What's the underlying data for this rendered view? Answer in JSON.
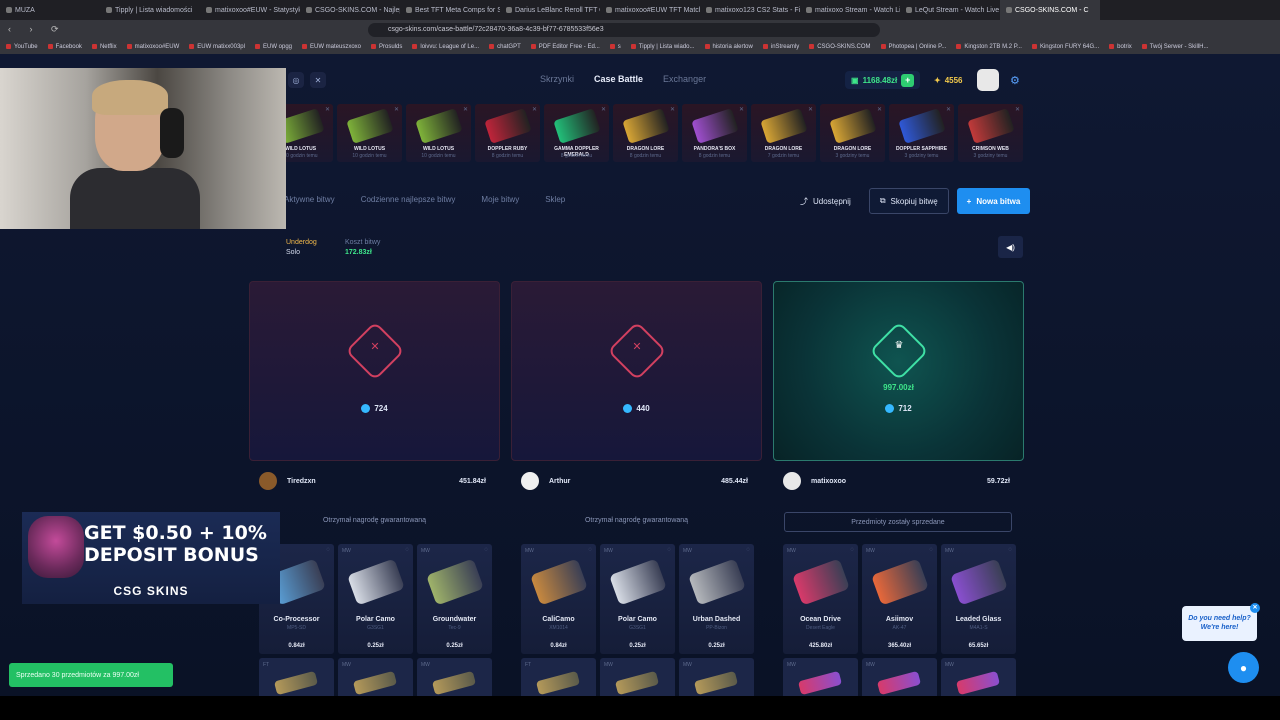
{
  "browser": {
    "tabs": [
      "MUZA",
      "Tipply | Lista wiadomości",
      "matixoxoo#EUW - Statystyki",
      "CSGO-SKINS.COM - Najlepsz",
      "Best TFT Meta Comps for Set",
      "Darius LeBlanc Reroll TFT Co",
      "matixoxoo#EUW TFT Match",
      "matixoxo123 CS2 Stats - Fi",
      "matixoxo Stream - Watch Li",
      "LeQut Stream - Watch Live o",
      "CSGO-SKINS.COM - C"
    ],
    "url": "csgo-skins.com/case-battle/72c28470-36a8-4c39-bf77-6785533f56e3",
    "bookmarks": [
      "YouTube",
      "Facebook",
      "Netflix",
      "matixoxoo#EUW",
      "EUW matixx003pl",
      "EUW opgg",
      "EUW mateuszxoxo",
      "Prosulds",
      "loivvu: League of Le...",
      "chatGPT",
      "PDF Editor Free - Ed...",
      "s",
      "Tipply | Lista wiado...",
      "historia alertow",
      "inStreamly",
      "CSGO-SKINS.COM",
      "Photopea | Online P...",
      "Kingston 2TB M.2 P...",
      "Kingston FURY 64G...",
      "botrix",
      "Twój Serwer - SkillH..."
    ]
  },
  "header": {
    "nav": [
      "Skrzynki",
      "Case Battle",
      "Exchanger"
    ],
    "balance": "1168.48zł",
    "coins": "4556"
  },
  "live_drops": [
    {
      "name": "WILD LOTUS",
      "time": "10 godzin temu",
      "color": "#7fb33a"
    },
    {
      "name": "WILD LOTUS",
      "time": "10 godzin temu",
      "color": "#7fb33a"
    },
    {
      "name": "WILD LOTUS",
      "time": "10 godzin temu",
      "color": "#7fb33a"
    },
    {
      "name": "DOPPLER RUBY",
      "time": "8 godzin temu",
      "color": "#c0243a"
    },
    {
      "name": "GAMMA DOPPLER EMERALD",
      "time": "8 godzin temu",
      "color": "#22c07a"
    },
    {
      "name": "DRAGON LORE",
      "time": "8 godzin temu",
      "color": "#d9a635"
    },
    {
      "name": "PANDORA'S BOX",
      "time": "8 godzin temu",
      "color": "#a04fd0"
    },
    {
      "name": "DRAGON LORE",
      "time": "7 godzin temu",
      "color": "#d9a635"
    },
    {
      "name": "DRAGON LORE",
      "time": "3 godziny temu",
      "color": "#d9a635"
    },
    {
      "name": "DOPPLER SAPPHIRE",
      "time": "3 godziny temu",
      "color": "#2f59d8"
    },
    {
      "name": "CRIMSON WEB",
      "time": "3 godziny temu",
      "color": "#c23a3a"
    }
  ],
  "subtabs": [
    "Aktywne bitwy",
    "Codzienne najlepsze bitwy",
    "Moje bitwy",
    "Sklep"
  ],
  "actions": {
    "share": "Udostępnij",
    "copy": "Skopiuj bitwę",
    "new": "Nowa bitwa"
  },
  "battle": {
    "mode_a": "Underdog",
    "mode_b": "Solo",
    "cost_label": "Koszt bitwy",
    "cost_value": "172.83zł"
  },
  "players": [
    {
      "name": "Tiredzxn",
      "total": "451.84zł",
      "tickets": "724",
      "note": "Otrzymał nagrodę gwarantowaną",
      "winner": false,
      "items": [
        {
          "cond": "MW",
          "name": "Co-Processor",
          "sub": "MP5-SD",
          "price": "0.84zł",
          "color": "#5aa0d8"
        },
        {
          "cond": "MW",
          "name": "Polar Camo",
          "sub": "G3SG1",
          "price": "0.25zł",
          "color": "#d8dde6"
        },
        {
          "cond": "MW",
          "name": "Groundwater",
          "sub": "Tec-9",
          "price": "0.25zł",
          "color": "#9fb36a"
        }
      ],
      "next": [
        "FT",
        "MW",
        "MW"
      ]
    },
    {
      "name": "Arthur",
      "total": "485.44zł",
      "tickets": "440",
      "note": "Otrzymał nagrodę gwarantowaną",
      "winner": false,
      "items": [
        {
          "cond": "MW",
          "name": "CaliCamo",
          "sub": "XM1014",
          "price": "0.84zł",
          "color": "#c8893f"
        },
        {
          "cond": "MW",
          "name": "Polar Camo",
          "sub": "G3SG1",
          "price": "0.25zł",
          "color": "#d8dde6"
        },
        {
          "cond": "MW",
          "name": "Urban Dashed",
          "sub": "PP-Bizon",
          "price": "0.25zł",
          "color": "#b6b9bd"
        }
      ],
      "next": [
        "FT",
        "MW",
        "MW"
      ]
    },
    {
      "name": "matixoxoo",
      "total": "59.72zł",
      "tickets": "712",
      "note": "Przedmioty zostały sprzedane",
      "winner": true,
      "win_amount": "997.00zł",
      "items": [
        {
          "cond": "MW",
          "name": "Ocean Drive",
          "sub": "Desert Eagle",
          "price": "425.80zł",
          "color": "#d83a6a"
        },
        {
          "cond": "MW",
          "name": "Asiimov",
          "sub": "AK-47",
          "price": "365.40zł",
          "color": "#e8683a"
        },
        {
          "cond": "MW",
          "name": "Leaded Glass",
          "sub": "M4A1-S",
          "price": "65.65zł",
          "color": "#8a4fd0"
        }
      ],
      "next": [
        "MW",
        "MW",
        "MW"
      ]
    }
  ],
  "promo": {
    "headline": "GET $0.50 + 10% DEPOSIT BONUS",
    "brand": "CSG SKINS"
  },
  "toast": "Sprzedano 30 przedmiotów za 997.00zł",
  "help": {
    "line1": "Do you need help?",
    "line2": "We're here!"
  }
}
